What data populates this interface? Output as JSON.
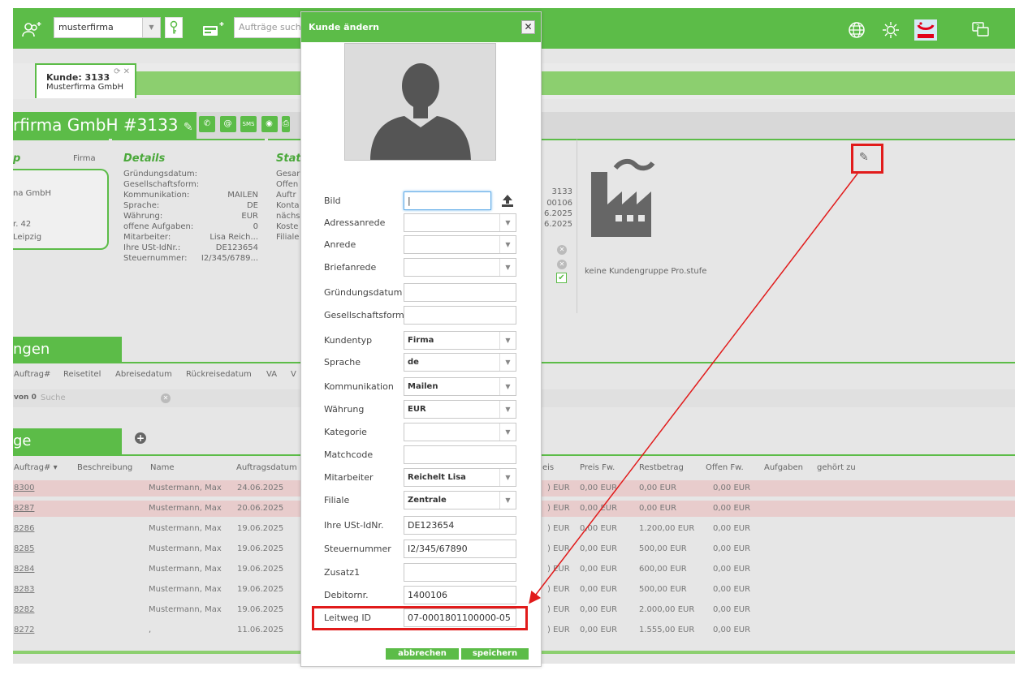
{
  "topbar": {
    "company_select": "musterfirma",
    "orders_search_placeholder": "Aufträge such"
  },
  "tab": {
    "title": "Kunde: 3133",
    "subtitle": "Musterfirma GmbH"
  },
  "header": {
    "title": "rfirma GmbH #3133",
    "buttons": [
      "✆",
      "@",
      "SMS",
      "◉",
      "⎙"
    ]
  },
  "typ": {
    "heading": "p",
    "value": "Firma",
    "address": [
      "na GmbH",
      "r. 42",
      "Leipzig"
    ]
  },
  "details": {
    "heading": "Details",
    "rows": [
      {
        "label": "Gründungsdatum:",
        "value": ""
      },
      {
        "label": "Gesellschaftsform:",
        "value": ""
      },
      {
        "label": "Kommunikation:",
        "value": "MAILEN"
      },
      {
        "label": "Sprache:",
        "value": "DE"
      },
      {
        "label": "Währung:",
        "value": "EUR"
      },
      {
        "label": "offene Aufgaben:",
        "value": "0"
      },
      {
        "label": "Mitarbeiter:",
        "value": "Lisa Reich..."
      },
      {
        "label": "Ihre USt-IdNr.:",
        "value": "DE123654"
      },
      {
        "label": "Steuernummer:",
        "value": "I2/345/6789..."
      }
    ]
  },
  "status": {
    "heading": "Stat",
    "labels": [
      "Gesar",
      "Offen",
      "Auftr",
      "Konta",
      "nächs",
      "Koste",
      "Filiale"
    ],
    "values": [
      "3133",
      "00106",
      "6.2025",
      "6.2025"
    ]
  },
  "kundengruppe": {
    "text": "keine Kundengruppe Pro.stufe"
  },
  "bookings": {
    "title": "ngen",
    "columns": [
      "Auftrag#",
      "Reisetitel",
      "Abreisedatum",
      "Rückreisedatum",
      "VA",
      "V"
    ],
    "count_label": "von 0",
    "search_placeholder": "Suche"
  },
  "orders": {
    "title": "ge",
    "add_icon": "plus-circle-icon",
    "columns_left": [
      "Auftrag# ▾",
      "Beschreibung",
      "Name",
      "Auftragsdatum"
    ],
    "columns_right": [
      "eis",
      "Preis Fw.",
      "Restbetrag",
      "Offen Fw.",
      "Aufgaben",
      "gehört zu"
    ],
    "rows": [
      {
        "id": "8300",
        "name": "Mustermann, Max",
        "date": "24.06.2025",
        "preis": ") EUR",
        "preis_fw": "0,00 EUR",
        "rest": "0,00 EUR",
        "offen": "0,00 EUR",
        "color": "#e8cccc"
      },
      {
        "id": "8287",
        "name": "Mustermann, Max",
        "date": "20.06.2025",
        "preis": ") EUR",
        "preis_fw": "0,00 EUR",
        "rest": "0,00 EUR",
        "offen": "0,00 EUR",
        "color": "#e8cccc"
      },
      {
        "id": "8286",
        "name": "Mustermann, Max",
        "date": "19.06.2025",
        "preis": ") EUR",
        "preis_fw": "0,00 EUR",
        "rest": "1.200,00 EUR",
        "offen": "0,00 EUR",
        "color": "#e6e6e6"
      },
      {
        "id": "8285",
        "name": "Mustermann, Max",
        "date": "19.06.2025",
        "preis": ") EUR",
        "preis_fw": "0,00 EUR",
        "rest": "500,00 EUR",
        "offen": "0,00 EUR",
        "color": "#e6e6e6"
      },
      {
        "id": "8284",
        "name": "Mustermann, Max",
        "date": "19.06.2025",
        "preis": ") EUR",
        "preis_fw": "0,00 EUR",
        "rest": "600,00 EUR",
        "offen": "0,00 EUR",
        "color": "#e6e6e6"
      },
      {
        "id": "8283",
        "name": "Mustermann, Max",
        "date": "19.06.2025",
        "preis": ") EUR",
        "preis_fw": "0,00 EUR",
        "rest": "500,00 EUR",
        "offen": "0,00 EUR",
        "color": "#e6e6e6"
      },
      {
        "id": "8282",
        "name": "Mustermann, Max",
        "date": "19.06.2025",
        "preis": ") EUR",
        "preis_fw": "0,00 EUR",
        "rest": "2.000,00 EUR",
        "offen": "0,00 EUR",
        "color": "#e6e6e6"
      },
      {
        "id": "8272",
        "name": ",",
        "date": "11.06.2025",
        "preis": ") EUR",
        "preis_fw": "0,00 EUR",
        "rest": "1.555,00 EUR",
        "offen": "0,00 EUR",
        "color": "#e6e6e6"
      }
    ]
  },
  "modal": {
    "title": "Kunde ändern",
    "close": "✕",
    "fields": [
      {
        "label": "Bild",
        "type": "file",
        "value": ""
      },
      {
        "label": "Adressanrede",
        "type": "select",
        "value": ""
      },
      {
        "label": "Anrede",
        "type": "select",
        "value": ""
      },
      {
        "label": "Briefanrede",
        "type": "select",
        "value": ""
      },
      {
        "label": "Gründungsdatum",
        "type": "text",
        "value": ""
      },
      {
        "label": "Gesellschaftsform",
        "type": "text",
        "value": ""
      },
      {
        "label": "Kundentyp",
        "type": "select",
        "value": "Firma"
      },
      {
        "label": "Sprache",
        "type": "select",
        "value": "de"
      },
      {
        "label": "Kommunikation",
        "type": "select",
        "value": "Mailen"
      },
      {
        "label": "Währung",
        "type": "select",
        "value": "EUR"
      },
      {
        "label": "Kategorie",
        "type": "select",
        "value": ""
      },
      {
        "label": "Matchcode",
        "type": "text",
        "value": ""
      },
      {
        "label": "Mitarbeiter",
        "type": "select",
        "value": "Reichelt Lisa"
      },
      {
        "label": "Filiale",
        "type": "select",
        "value": "Zentrale"
      },
      {
        "label": "Ihre USt-IdNr.",
        "type": "text",
        "value": "DE123654"
      },
      {
        "label": "Steuernummer",
        "type": "text",
        "value": "I2/345/67890"
      },
      {
        "label": "Zusatz1",
        "type": "text",
        "value": ""
      },
      {
        "label": "Debitornr.",
        "type": "text",
        "value": "1400106"
      },
      {
        "label": "Leitweg ID",
        "type": "text",
        "value": "07-0001801100000-05"
      }
    ],
    "cancel": "abbrechen",
    "save": "speichern"
  },
  "colors": {
    "green": "#5cbc48",
    "light_green": "#8ccf6f",
    "highlight_red": "#e11b1b"
  }
}
